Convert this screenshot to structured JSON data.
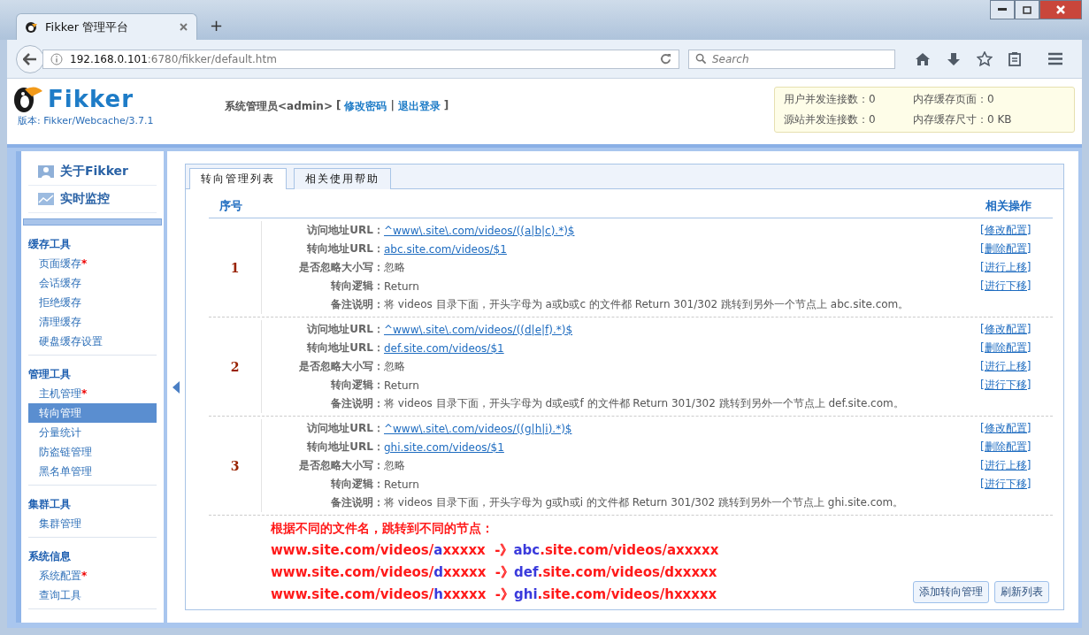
{
  "browser": {
    "tab_title": "Fikker 管理平台",
    "new_tab": "+",
    "url_host": "192.168.0.101",
    "url_path": ":6780/fikker/default.htm",
    "search_placeholder": "Search"
  },
  "header": {
    "logo_text": "Fikker",
    "version_label": "版本:",
    "version": "Fikker/Webcache/3.7.1",
    "user": "系统管理员<admin>",
    "bracket_open": "[",
    "links": [
      "修改密码",
      "退出登录"
    ],
    "separator": "|",
    "bracket_close": "]"
  },
  "stats": [
    "用户并发连接数：0",
    "内存缓存页面：0",
    "源站并发连接数：0",
    "内存缓存尺寸：0 KB"
  ],
  "sidebar": {
    "top_items": [
      {
        "label": "关于Fikker",
        "kind": "person"
      },
      {
        "label": "实时监控",
        "kind": "chart"
      }
    ],
    "groups": [
      {
        "title": "缓存工具",
        "items": [
          {
            "label": "页面缓存",
            "badge": "*",
            "selected": false
          },
          {
            "label": "会话缓存",
            "selected": false
          },
          {
            "label": "拒绝缓存",
            "selected": false
          },
          {
            "label": "清理缓存",
            "selected": false
          },
          {
            "label": "硬盘缓存设置",
            "selected": false
          }
        ]
      },
      {
        "title": "管理工具",
        "items": [
          {
            "label": "主机管理",
            "badge": "*",
            "selected": false
          },
          {
            "label": "转向管理",
            "selected": true
          },
          {
            "label": "分量统计",
            "selected": false
          },
          {
            "label": "防盗链管理",
            "selected": false
          },
          {
            "label": "黑名单管理",
            "selected": false
          }
        ]
      },
      {
        "title": "集群工具",
        "items": [
          {
            "label": "集群管理",
            "selected": false
          }
        ]
      },
      {
        "title": "系统信息",
        "items": [
          {
            "label": "系统配置",
            "badge": "*",
            "selected": false
          },
          {
            "label": "查询工具",
            "selected": false
          }
        ]
      }
    ]
  },
  "tabs": [
    {
      "label": "转向管理列表",
      "selected": true
    },
    {
      "label": "相关使用帮助",
      "selected": false
    }
  ],
  "table": {
    "columns": [
      "序号",
      "相关操作"
    ],
    "rows": [
      {
        "number": "1",
        "fields": [
          {
            "label": "访问地址URL：",
            "value": "^www\\.site\\.com/videos/((a|b|c).*)$",
            "kind": "link"
          },
          {
            "label": "转向地址URL：",
            "value": "abc.site.com/videos/$1",
            "kind": "link"
          },
          {
            "label": "是否忽略大小写：",
            "value": "忽略",
            "kind": "text"
          },
          {
            "label": "转向逻辑：",
            "value": "Return",
            "kind": "text"
          },
          {
            "label": "备注说明：",
            "value": "将 videos 目录下面，开头字母为 a或b或c 的文件都 Return 301/302 跳转到另外一个节点上 abc.site.com。",
            "kind": "text"
          }
        ],
        "actions": [
          "[修改配置]",
          "[删除配置]",
          "[进行上移]",
          "[进行下移]"
        ]
      },
      {
        "number": "2",
        "fields": [
          {
            "label": "访问地址URL：",
            "value": "^www\\.site\\.com/videos/((d|e|f).*)$",
            "kind": "link"
          },
          {
            "label": "转向地址URL：",
            "value": "def.site.com/videos/$1",
            "kind": "link"
          },
          {
            "label": "是否忽略大小写：",
            "value": "忽略",
            "kind": "text"
          },
          {
            "label": "转向逻辑：",
            "value": "Return",
            "kind": "text"
          },
          {
            "label": "备注说明：",
            "value": "将 videos 目录下面，开头字母为 d或e或f 的文件都 Return 301/302 跳转到另外一个节点上 def.site.com。",
            "kind": "text"
          }
        ],
        "actions": [
          "[修改配置]",
          "[删除配置]",
          "[进行上移]",
          "[进行下移]"
        ]
      },
      {
        "number": "3",
        "fields": [
          {
            "label": "访问地址URL：",
            "value": "^www\\.site\\.com/videos/((g|h|i).*)$",
            "kind": "link"
          },
          {
            "label": "转向地址URL：",
            "value": "ghi.site.com/videos/$1",
            "kind": "link"
          },
          {
            "label": "是否忽略大小写：",
            "value": "忽略",
            "kind": "text"
          },
          {
            "label": "转向逻辑：",
            "value": "Return",
            "kind": "text"
          },
          {
            "label": "备注说明：",
            "value": "将 videos 目录下面，开头字母为 g或h或i 的文件都 Return 301/302 跳转到另外一个节点上 ghi.site.com。",
            "kind": "text"
          }
        ],
        "actions": [
          "[修改配置]",
          "[删除配置]",
          "[进行上移]",
          "[进行下移]"
        ]
      }
    ]
  },
  "note": {
    "title": "根据不同的文件名，跳转到不同的节点：",
    "lines": [
      [
        {
          "text": "www.site.com/videos/",
          "color": "#ff1a1a"
        },
        {
          "text": "a",
          "color": "#3a3adc"
        },
        {
          "text": "xxxxx  -》",
          "color": "#ff1a1a"
        },
        {
          "text": "abc",
          "color": "#3a3adc"
        },
        {
          "text": ".site.com/videos/axxxxx",
          "color": "#ff1a1a"
        }
      ],
      [
        {
          "text": "www.site.com/videos/",
          "color": "#ff1a1a"
        },
        {
          "text": "d",
          "color": "#3a3adc"
        },
        {
          "text": "xxxxx  -》",
          "color": "#ff1a1a"
        },
        {
          "text": "def",
          "color": "#3a3adc"
        },
        {
          "text": ".site.com/videos/dxxxxx",
          "color": "#ff1a1a"
        }
      ],
      [
        {
          "text": "www.site.com/videos/",
          "color": "#ff1a1a"
        },
        {
          "text": "h",
          "color": "#3a3adc"
        },
        {
          "text": "xxxxx  -》",
          "color": "#ff1a1a"
        },
        {
          "text": "ghi",
          "color": "#3a3adc"
        },
        {
          "text": ".site.com/videos/hxxxxx",
          "color": "#ff1a1a"
        }
      ]
    ]
  },
  "buttons": [
    "添加转向管理",
    "刷新列表"
  ]
}
